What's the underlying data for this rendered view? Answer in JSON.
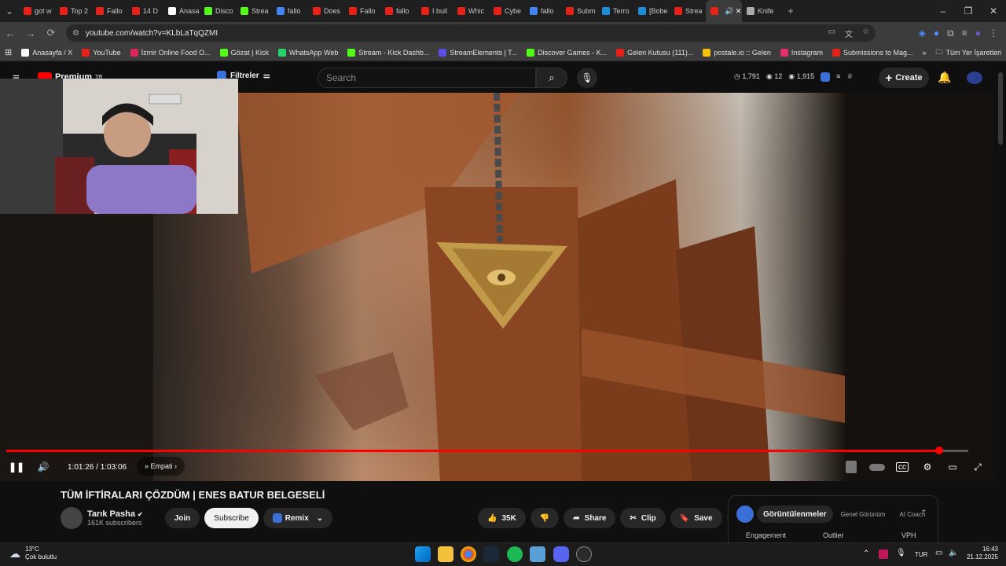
{
  "browser": {
    "tabs": [
      {
        "label": "got w",
        "color": "#e62117"
      },
      {
        "label": "Top 2",
        "color": "#e62117"
      },
      {
        "label": "Fallo",
        "color": "#e62117"
      },
      {
        "label": "14 D",
        "color": "#e62117"
      },
      {
        "label": "Anasa",
        "color": "#ffffff"
      },
      {
        "label": "Disco",
        "color": "#53fc18"
      },
      {
        "label": "Strea",
        "color": "#53fc18"
      },
      {
        "label": "fallo",
        "color": "#4285f4"
      },
      {
        "label": "Does",
        "color": "#e62117"
      },
      {
        "label": "Fallo",
        "color": "#e62117"
      },
      {
        "label": "fallo",
        "color": "#e62117"
      },
      {
        "label": "I buil",
        "color": "#e62117"
      },
      {
        "label": "Whic",
        "color": "#e62117"
      },
      {
        "label": "Cybe",
        "color": "#e62117"
      },
      {
        "label": "fallo",
        "color": "#4285f4"
      },
      {
        "label": "Subm",
        "color": "#e62117"
      },
      {
        "label": "Terro",
        "color": "#1b8cd8"
      },
      {
        "label": "[Bobe",
        "color": "#1b8cd8"
      },
      {
        "label": "Strea",
        "color": "#e62117"
      },
      {
        "label": "",
        "color": "#e62117"
      },
      {
        "label": "Knife",
        "color": "#aaaaaa"
      }
    ],
    "new_tab": "+",
    "url": "youtube.com/watch?v=KLbLaTqQZMI",
    "bookmarks": [
      {
        "label": "Anasayfa / X",
        "color": "#ffffff"
      },
      {
        "label": "YouTube",
        "color": "#e62117"
      },
      {
        "label": "İzmir Online Food O...",
        "color": "#d6285a"
      },
      {
        "label": "Gözat | Kick",
        "color": "#53fc18"
      },
      {
        "label": "WhatsApp Web",
        "color": "#25d366"
      },
      {
        "label": "Stream - Kick Dashb...",
        "color": "#53fc18"
      },
      {
        "label": "StreamElements | T...",
        "color": "#5b4fe6"
      },
      {
        "label": "Discover Games - K...",
        "color": "#53fc18"
      },
      {
        "label": "Gelen Kutusu (111)...",
        "color": "#e62117"
      },
      {
        "label": "postale.io :: Gelen",
        "color": "#f4c20d"
      },
      {
        "label": "Instagram",
        "color": "#e1306c"
      },
      {
        "label": "Submissions to Mag...",
        "color": "#e62117"
      }
    ],
    "all_bookmarks": "Tüm Yer İşaretleri"
  },
  "youtube": {
    "logo_text": "Premium",
    "logo_region": "TR",
    "filters": "Filtreler",
    "search_placeholder": "Search",
    "stats": [
      "1,791",
      "12",
      "1,915"
    ],
    "create": "Create"
  },
  "player": {
    "time": "1:01:26 / 1:03:06",
    "chapter": "» Empati",
    "progress": 0.97
  },
  "video": {
    "title": "TÜM İFTİRALARI ÇÖZDÜM | ENES BATUR BELGESELİ",
    "channel": "Tarık Pasha",
    "subscribers": "161K subscribers",
    "join": "Join",
    "subscribe": "Subscribe",
    "remix": "Remix",
    "likes": "35K",
    "share": "Share",
    "clip": "Clip",
    "save": "Save"
  },
  "side_panel": {
    "tabs": [
      "Görüntülenmeler",
      "Genel Görünüm",
      "AI Coach"
    ],
    "cols": [
      "Engagement",
      "Outlier",
      "VPH"
    ]
  },
  "taskbar": {
    "temp": "13°C",
    "weather": "Çok bulutlu",
    "lang": "TUR",
    "time": "16:43",
    "date": "21.12.2025"
  }
}
